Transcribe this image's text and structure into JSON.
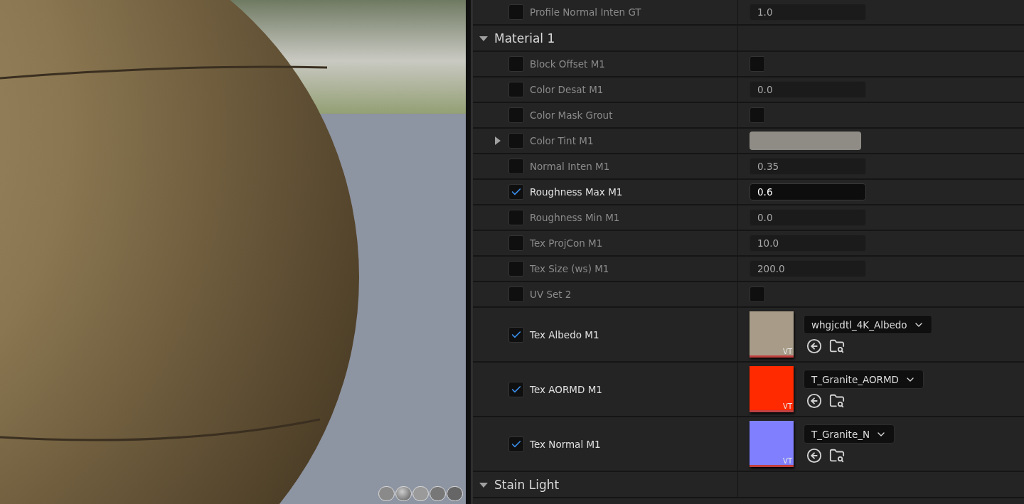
{
  "details": {
    "rows": [
      {
        "kind": "number",
        "name": "Profile Normal Inten GT",
        "enabled": false,
        "value": "1.0",
        "focused": false
      },
      {
        "kind": "section",
        "name": "Material 1",
        "expanded": true
      },
      {
        "kind": "toggle",
        "name": "Block Offset M1",
        "enabled": false,
        "value_checked": false
      },
      {
        "kind": "number",
        "name": "Color Desat M1",
        "enabled": false,
        "value": "0.0",
        "focused": false
      },
      {
        "kind": "toggle",
        "name": "Color Mask Grout",
        "enabled": false,
        "value_checked": false
      },
      {
        "kind": "color",
        "name": "Color Tint M1",
        "enabled": false,
        "color": "#8f8c86",
        "expanded": false
      },
      {
        "kind": "number",
        "name": "Normal Inten M1",
        "enabled": false,
        "value": "0.35",
        "focused": false
      },
      {
        "kind": "number",
        "name": "Roughness Max M1",
        "enabled": true,
        "value": "0.6",
        "focused": true
      },
      {
        "kind": "number",
        "name": "Roughness Min M1",
        "enabled": false,
        "value": "0.0",
        "focused": false
      },
      {
        "kind": "number",
        "name": "Tex ProjCon M1",
        "enabled": false,
        "value": "10.0",
        "focused": false
      },
      {
        "kind": "number",
        "name": "Tex Size (ws) M1",
        "enabled": false,
        "value": "200.0",
        "focused": false
      },
      {
        "kind": "toggle",
        "name": "UV Set 2",
        "enabled": false,
        "value_checked": false
      },
      {
        "kind": "texture",
        "name": "Tex Albedo M1",
        "enabled": true,
        "color": "#a89c88",
        "badge": "VT",
        "asset": "whgjcdtl_4K_Albedo"
      },
      {
        "kind": "texture",
        "name": "Tex AORMD M1",
        "enabled": true,
        "color": "#ff2a00",
        "badge": "VT",
        "asset": "T_Granite_AORMD"
      },
      {
        "kind": "texture",
        "name": "Tex Normal M1",
        "enabled": true,
        "color": "#8080ff",
        "badge": "VT",
        "asset": "T_Granite_N"
      },
      {
        "kind": "section",
        "name": "Stain Light",
        "expanded": true
      }
    ]
  }
}
